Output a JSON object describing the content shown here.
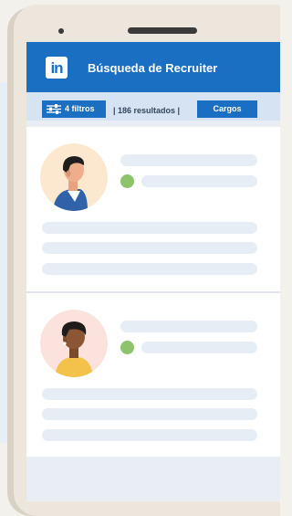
{
  "header": {
    "logo_text": "in",
    "title": "Búsqueda de Recruiter"
  },
  "toolbar": {
    "filters_label": "4 filtros",
    "results_text": "| 186 resultados |",
    "cargos_label": "Cargos"
  },
  "colors": {
    "brand": "#1a6fc2",
    "online": "#8dc46b"
  },
  "icons": {
    "filters": "sliders-icon"
  }
}
